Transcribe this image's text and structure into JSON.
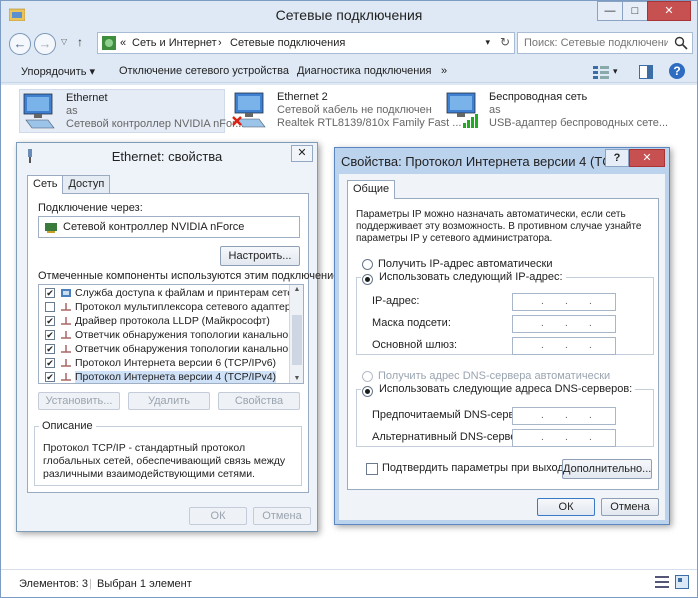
{
  "window": {
    "title": "Сетевые подключения",
    "minimize": "—",
    "maximize": "□",
    "close": "✕"
  },
  "address": {
    "prefix": "«",
    "crumb1": "Сеть и Интернет",
    "sep": "›",
    "crumb2": "Сетевые подключения",
    "search_placeholder": "Поиск: Сетевые подключения"
  },
  "toolbar": {
    "organize": "Упорядочить ▾",
    "disable": "Отключение сетевого устройства",
    "diagnose": "Диагностика подключения",
    "more": "»"
  },
  "connections": [
    {
      "name": "Ethernet",
      "line2": "as",
      "line3": "Сетевой контроллер NVIDIA nFor..."
    },
    {
      "name": "Ethernet 2",
      "line2": "Сетевой кабель не подключен",
      "line3": "Realtek RTL8139/810x Family Fast ..."
    },
    {
      "name": "Беспроводная сеть",
      "line2": "as",
      "line3": "USB-адаптер беспроводных сете..."
    }
  ],
  "status": {
    "items": "Элементов: 3",
    "selected": "Выбран 1 элемент"
  },
  "eth_dialog": {
    "title": "Ethernet: свойства",
    "close": "✕",
    "tab_net": "Сеть",
    "tab_access": "Доступ",
    "connect_via": "Подключение через:",
    "adapter": "Сетевой контроллер NVIDIA nForce",
    "configure": "Настроить...",
    "components_label": "Отмеченные компоненты используются этим подключением:",
    "components": [
      {
        "checked": true,
        "text": "Служба доступа к файлам и принтерам сетей Micro"
      },
      {
        "checked": false,
        "text": "Протокол мультиплексора сетевого адаптера (Майк"
      },
      {
        "checked": true,
        "text": "Драйвер протокола LLDP (Майкрософт)"
      },
      {
        "checked": true,
        "text": "Ответчик обнаружения топологии канального уров"
      },
      {
        "checked": true,
        "text": "Ответчик обнаружения топологии канального уров"
      },
      {
        "checked": true,
        "text": "Протокол Интернета версии 6 (TCP/IPv6)"
      },
      {
        "checked": true,
        "text": "Протокол Интернета версии 4 (TCP/IPv4)"
      }
    ],
    "install": "Установить...",
    "remove": "Удалить",
    "properties": "Свойства",
    "desc_title": "Описание",
    "desc_text": "Протокол TCP/IP - стандартный протокол глобальных сетей, обеспечивающий связь между различными взаимодействующими сетями.",
    "ok": "ОК",
    "cancel": "Отмена"
  },
  "ipv4_dialog": {
    "title": "Свойства: Протокол Интернета версии 4 (TCP/...",
    "help": "?",
    "close": "✕",
    "tab_general": "Общие",
    "intro": "Параметры IP можно назначать автоматически, если сеть поддерживает эту возможность. В противном случае узнайте параметры IP у сетевого администратора.",
    "auto_ip": "Получить IP-адрес автоматически",
    "manual_ip": "Использовать следующий IP-адрес:",
    "ip_label": "IP-адрес:",
    "mask_label": "Маска подсети:",
    "gateway_label": "Основной шлюз:",
    "auto_dns": "Получить адрес DNS-сервера автоматически",
    "manual_dns": "Использовать следующие адреса DNS-серверов:",
    "pref_dns": "Предпочитаемый DNS-сервер:",
    "alt_dns": "Альтернативный DNS-сервер:",
    "validate": "Подтвердить параметры при выходе",
    "advanced": "Дополнительно...",
    "ok": "ОК",
    "cancel": "Отмена",
    "ip_dots": ".",
    "colors": {
      "accent": "#bcd3ee",
      "close_red": "#c75050"
    }
  }
}
